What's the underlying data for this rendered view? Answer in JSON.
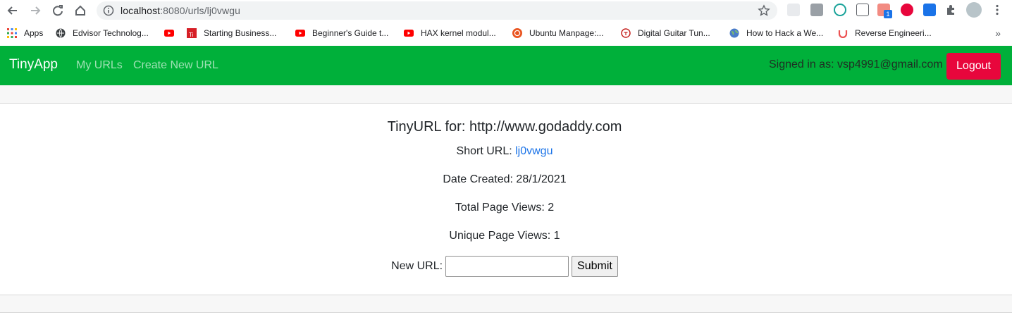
{
  "browser": {
    "url_host": "localhost",
    "url_rest": ":8080/urls/lj0vwgu",
    "icons": [
      "back-icon",
      "forward-icon",
      "reload-icon",
      "home-icon",
      "info-icon",
      "star-icon",
      "extensions-icon",
      "profile-avatar",
      "menu-icon"
    ],
    "extension_badge": "1"
  },
  "bookmarks": [
    {
      "label": "Apps",
      "icon": "apps-grid-icon"
    },
    {
      "label": "Edvisor Technolog...",
      "icon": "globe-icon"
    },
    {
      "label": "",
      "icon": "youtube-icon"
    },
    {
      "label": "Starting Business...",
      "icon": "ti-icon"
    },
    {
      "label": "Beginner's Guide t...",
      "icon": "youtube-icon"
    },
    {
      "label": "HAX kernel modul...",
      "icon": "youtube-icon"
    },
    {
      "label": "Ubuntu Manpage:...",
      "icon": "ubuntu-icon"
    },
    {
      "label": "Digital Guitar Tun...",
      "icon": "tuner-icon"
    },
    {
      "label": "How to Hack a We...",
      "icon": "globe-icon"
    },
    {
      "label": "Reverse Engineeri...",
      "icon": "udemy-icon"
    }
  ],
  "bookmarks_more": "»",
  "navbar": {
    "brand": "TinyApp",
    "links": [
      "My URLs",
      "Create New URL"
    ],
    "signed_in": "Signed in as: vsp4991@gmail.com",
    "logout": "Logout",
    "colors": {
      "bar": "#00b03a",
      "logout": "#e8063c"
    }
  },
  "card": {
    "title": "TinyURL for: http://www.godaddy.com",
    "short_url_label": "Short URL:",
    "short_url": "lj0vwgu",
    "date_created": "Date Created: 28/1/2021",
    "total_views": "Total Page Views: 2",
    "unique_views": "Unique Page Views: 1",
    "new_url_label": "New URL:",
    "new_url_value": "",
    "submit": "Submit"
  }
}
